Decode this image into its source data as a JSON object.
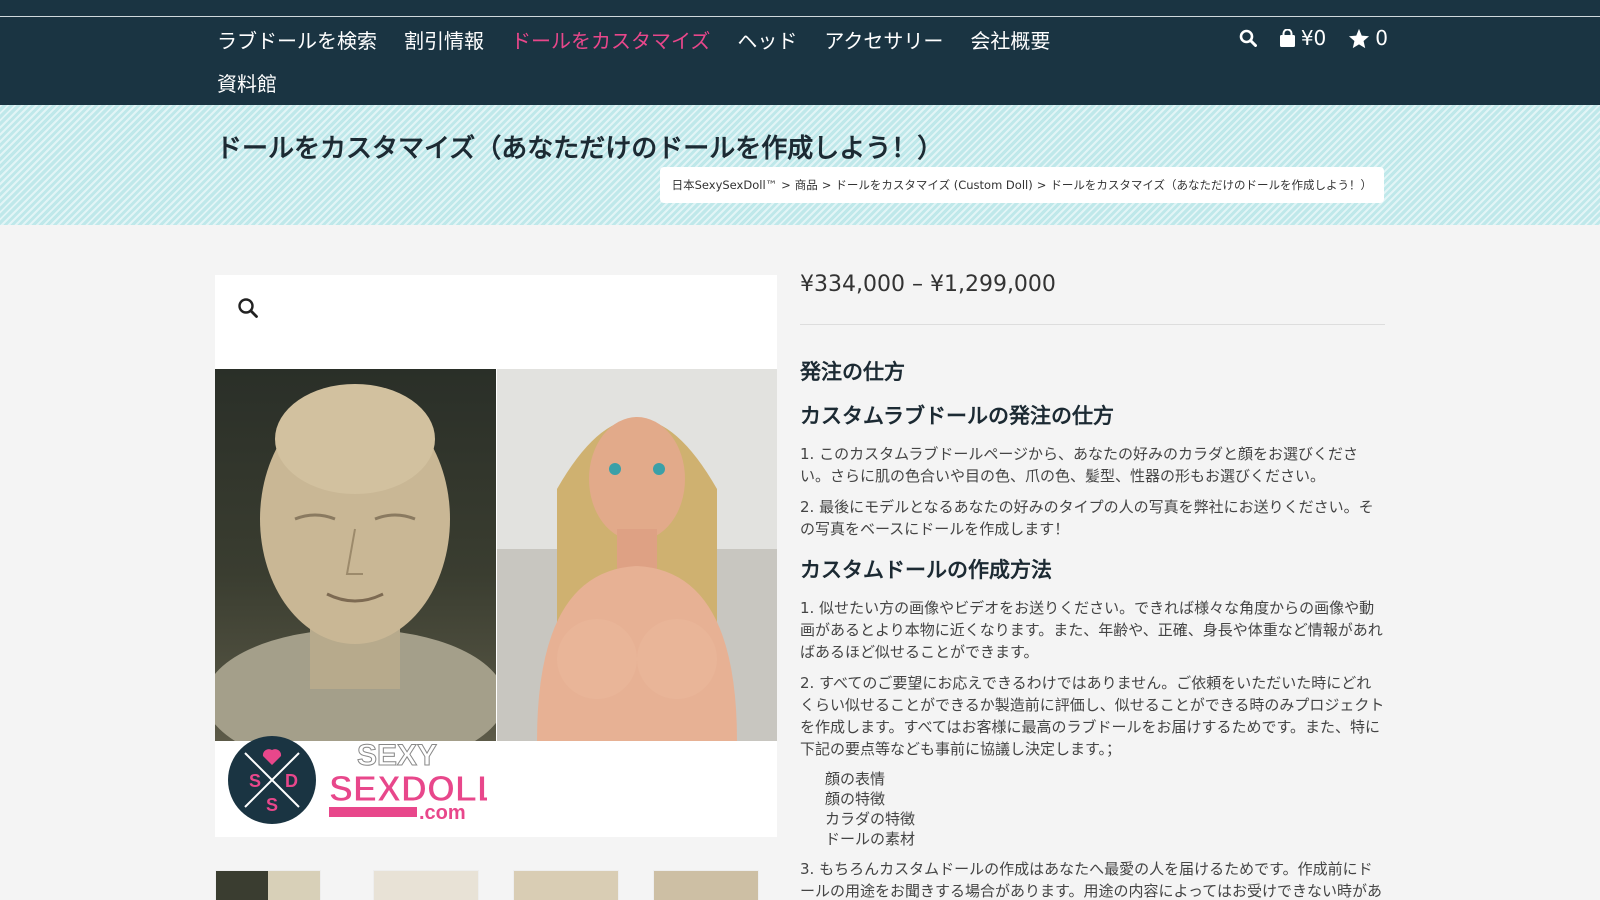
{
  "header": {
    "nav_row1": [
      "ラブドールを検索",
      "割引情報",
      "ドールをカスタマイズ",
      "ヘッド",
      "アクセサリー",
      "会社概要"
    ],
    "nav_row2": [
      "資料館"
    ],
    "active_index": 2,
    "cart_total": "¥0",
    "wishlist_count": "0",
    "icons": [
      "search-icon",
      "shopping-bag-icon",
      "star-icon"
    ]
  },
  "title_band": {
    "title": "ドールをカスタマイズ（あなただけのドールを作成しよう！）",
    "breadcrumb": [
      "日本SexySexDoll™",
      "商品",
      "ドールをカスタマイズ (Custom Doll)",
      "ドールをカスタマイズ（あなただけのドールを作成しよう！）"
    ],
    "breadcrumb_sep": ">"
  },
  "gallery": {
    "watermark": "SEXYSEX DOLL.COM",
    "logo_text_1": "SEXY",
    "logo_text_2": "SEXDOLL",
    "logo_text_3": ".com",
    "logo_letters": [
      "S",
      "D",
      "S"
    ]
  },
  "product": {
    "price": "¥334,000 – ¥1,299,000",
    "h_order": "発注の仕方",
    "h_custom_order": "カスタムラブドールの発注の仕方",
    "order_p1": "1. このカスタムラブドールページから、あなたの好みのカラダと顔をお選びください。さらに肌の色合いや目の色、爪の色、髪型、性器の形もお選びください。",
    "order_p2": "2. 最後にモデルとなるあなたの好みのタイプの人の写真を弊社にお送りください。その写真をベースにドールを作成します！",
    "h_method": "カスタムドールの作成方法",
    "method_p1": "1. 似せたい方の画像やビデオをお送りください。できれば様々な角度からの画像や動画があるとより本物に近くなります。また、年齢や、正確、身長や体重など情報があればあるほど似せることができます。",
    "method_p2": "2. すべてのご要望にお応えできるわけではありません。ご依頼をいただいた時にどれくらい似せることができるか製造前に評価し、似せることができる時のみプロジェクトを作成します。すべてはお客様に最高のラブドールをお届けするためです。また、特に下記の要点等なども事前に協議し決定します。；",
    "points": [
      "顔の表情",
      "顔の特徴",
      "カラダの特徴",
      "ドールの素材"
    ],
    "method_p3": "3. もちろんカスタムドールの作成はあなたへ最愛の人を届けるためです。作成前にドールの用途をお聞きする場合があります。用途の内容によってはお受けできない時があ"
  },
  "colors": {
    "header_bg": "#1a3442",
    "accent_pink": "#e8478b",
    "band_bg": "#bfe8ea"
  }
}
